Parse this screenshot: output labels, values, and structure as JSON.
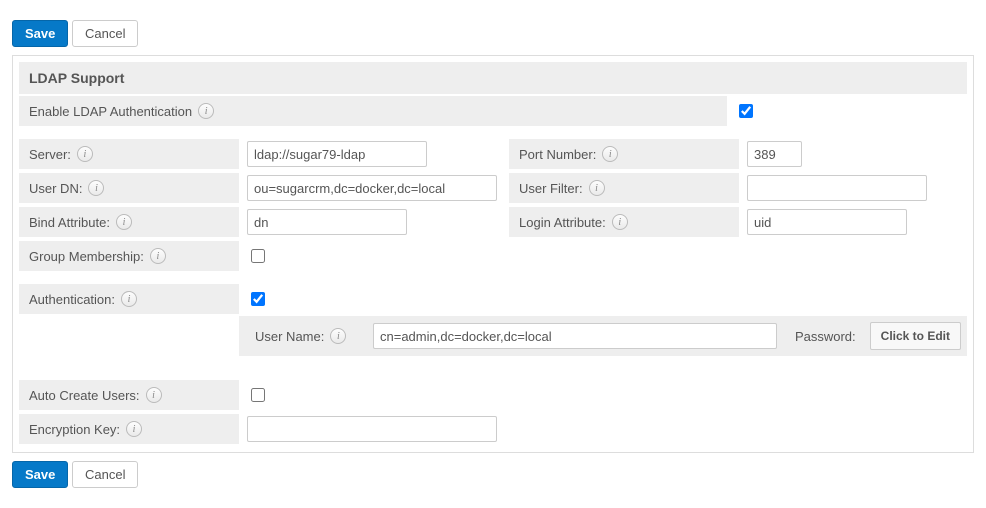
{
  "buttons": {
    "save": "Save",
    "cancel": "Cancel",
    "click_to_edit": "Click to Edit"
  },
  "section": {
    "title": "LDAP Support"
  },
  "fields": {
    "enable_label": "Enable LDAP Authentication",
    "enable_checked": true,
    "server_label": "Server:",
    "server_value": "ldap://sugar79-ldap",
    "port_label": "Port Number:",
    "port_value": "389",
    "userdn_label": "User DN:",
    "userdn_value": "ou=sugarcrm,dc=docker,dc=local",
    "userfilter_label": "User Filter:",
    "userfilter_value": "",
    "bindattr_label": "Bind Attribute:",
    "bindattr_value": "dn",
    "loginattr_label": "Login Attribute:",
    "loginattr_value": "uid",
    "groupmem_label": "Group Membership:",
    "groupmem_checked": false,
    "auth_label": "Authentication:",
    "auth_checked": true,
    "auth_username_label": "User Name:",
    "auth_username_value": "cn=admin,dc=docker,dc=local",
    "auth_password_label": "Password:",
    "autocreate_label": "Auto Create Users:",
    "autocreate_checked": false,
    "enckey_label": "Encryption Key:",
    "enckey_value": ""
  }
}
